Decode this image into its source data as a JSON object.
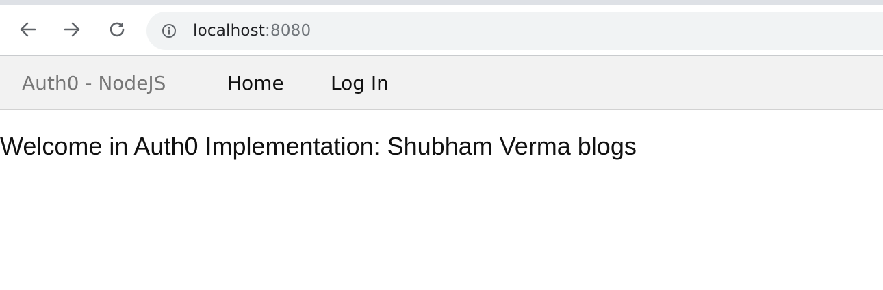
{
  "browser": {
    "address_bar": {
      "host": "localhost",
      "port": ":8080"
    },
    "icons": {
      "back": "arrow-left-icon",
      "forward": "arrow-right-icon",
      "reload": "reload-icon",
      "site_info": "info-icon"
    }
  },
  "navbar": {
    "brand": "Auth0 - NodeJS",
    "items": [
      {
        "label": "Home"
      },
      {
        "label": "Log In"
      }
    ]
  },
  "main": {
    "welcome_text": "Welcome in Auth0 Implementation: Shubham Verma blogs"
  },
  "colors": {
    "brand_text": "#777777",
    "nav_background": "#f2f2f2",
    "omnibox_background": "#f1f3f4",
    "text": "#111111"
  }
}
